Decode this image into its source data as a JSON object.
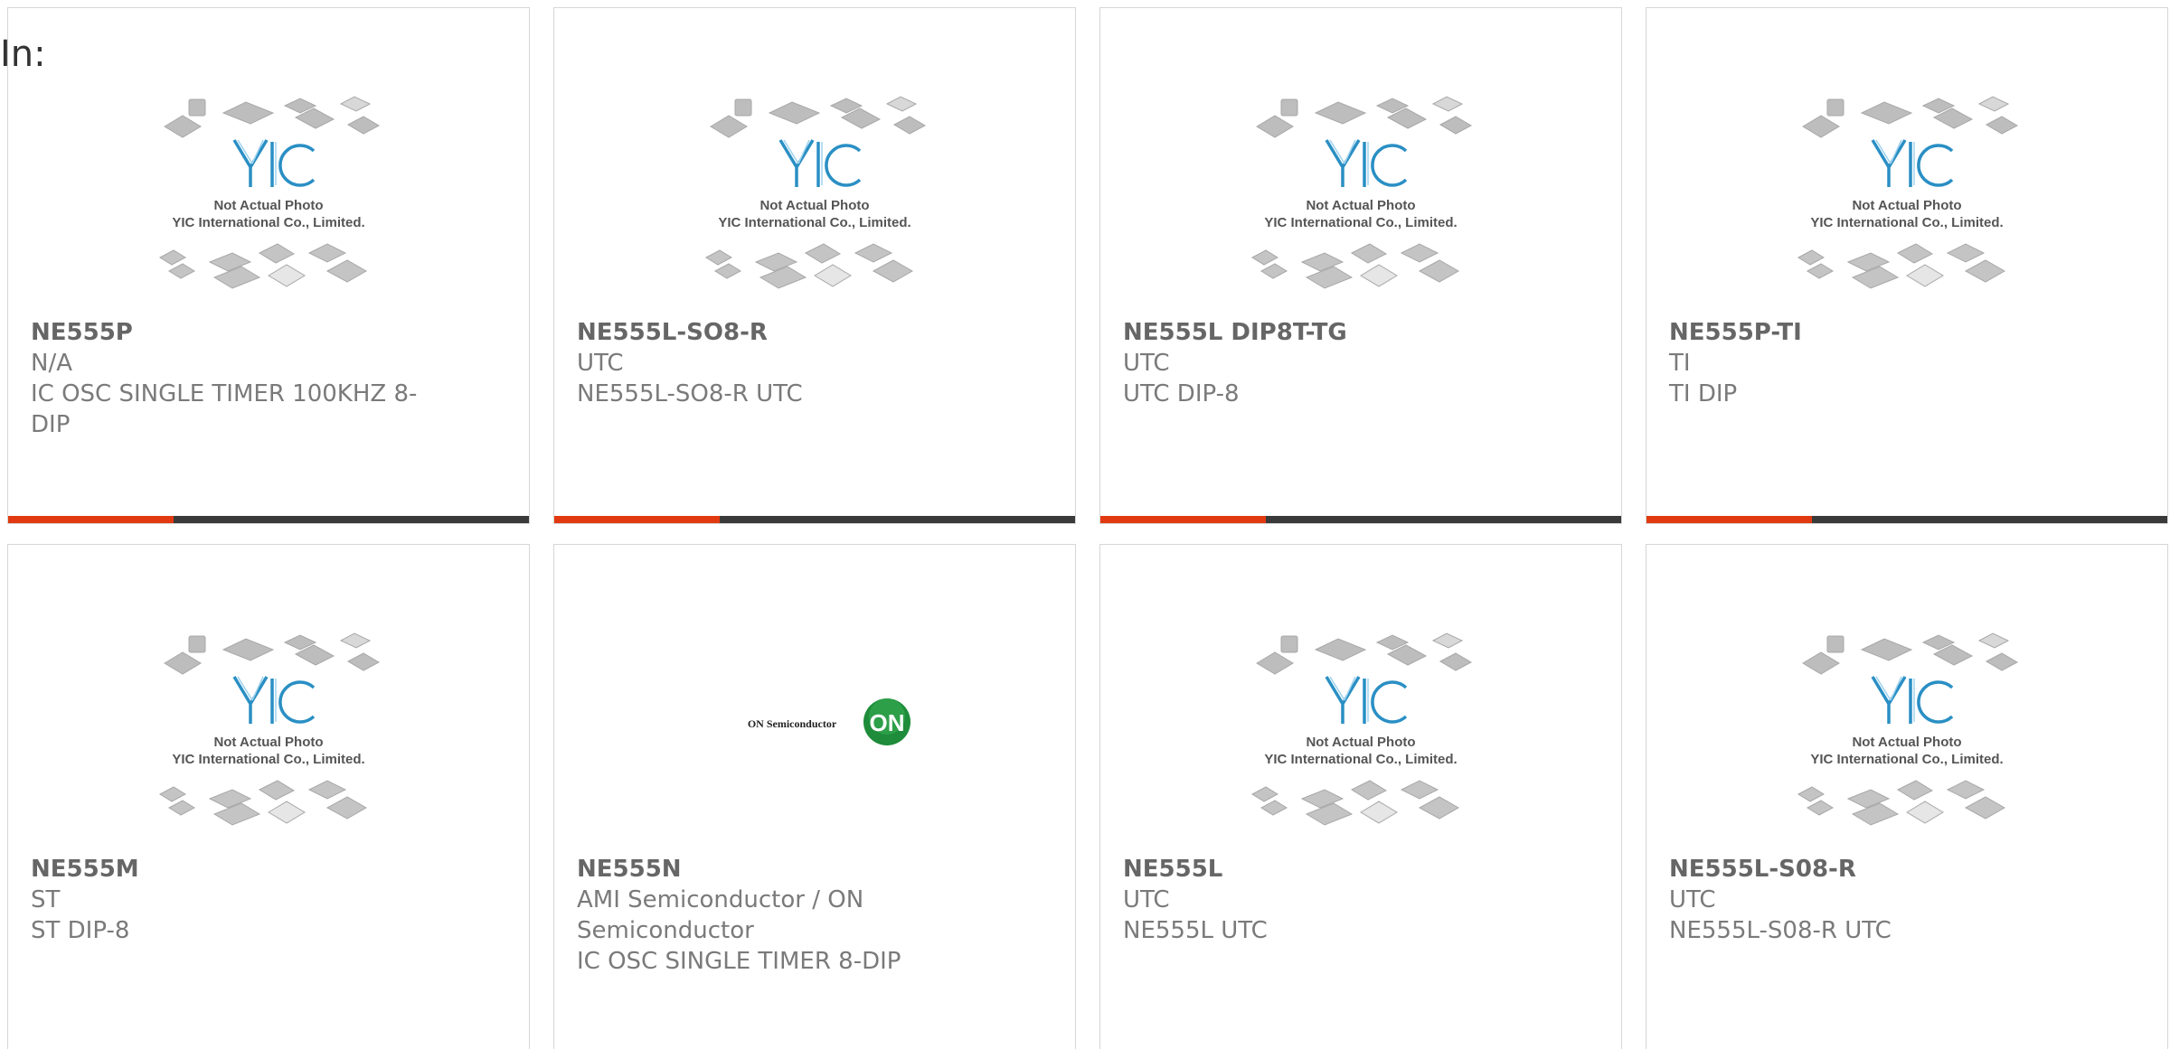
{
  "filter": {
    "label": "In:"
  },
  "thumbnail_text": {
    "line1": "Not Actual Photo",
    "line2": "YIC International Co., Limited.",
    "logo": "YIC",
    "on_semi_text": "ON Semiconductor",
    "on_logo": "ON"
  },
  "colors": {
    "accent": "#e13a11",
    "bar": "#3a3a3a",
    "border": "#d6d6d6",
    "yic_blue": "#2a8fc4",
    "on_green": "#1e8c3a"
  },
  "products": [
    {
      "part": "NE555P",
      "maker": "N/A",
      "desc": "IC OSC SINGLE TIMER 100KHZ 8-",
      "desc2": "DIP",
      "image": "yic-placeholder"
    },
    {
      "part": "NE555L-SO8-R",
      "maker": "UTC",
      "desc": "NE555L-SO8-R UTC",
      "desc2": "",
      "image": "yic-placeholder"
    },
    {
      "part": "NE555L DIP8T-TG",
      "maker": "UTC",
      "desc": "UTC DIP-8",
      "desc2": "",
      "image": "yic-placeholder"
    },
    {
      "part": "NE555P-TI",
      "maker": "TI",
      "desc": "TI DIP",
      "desc2": "",
      "image": "yic-placeholder"
    },
    {
      "part": "NE555M",
      "maker": "ST",
      "desc": "ST DIP-8",
      "desc2": "",
      "image": "yic-placeholder"
    },
    {
      "part": "NE555N",
      "maker": "AMI Semiconductor / ON",
      "maker2": "Semiconductor",
      "desc": "IC OSC SINGLE TIMER 8-DIP",
      "desc2": "",
      "image": "on-semi-logo"
    },
    {
      "part": "NE555L",
      "maker": "UTC",
      "desc": "NE555L UTC",
      "desc2": "",
      "image": "yic-placeholder"
    },
    {
      "part": "NE555L-S08-R",
      "maker": "UTC",
      "desc": "NE555L-S08-R UTC",
      "desc2": "",
      "image": "yic-placeholder"
    }
  ]
}
